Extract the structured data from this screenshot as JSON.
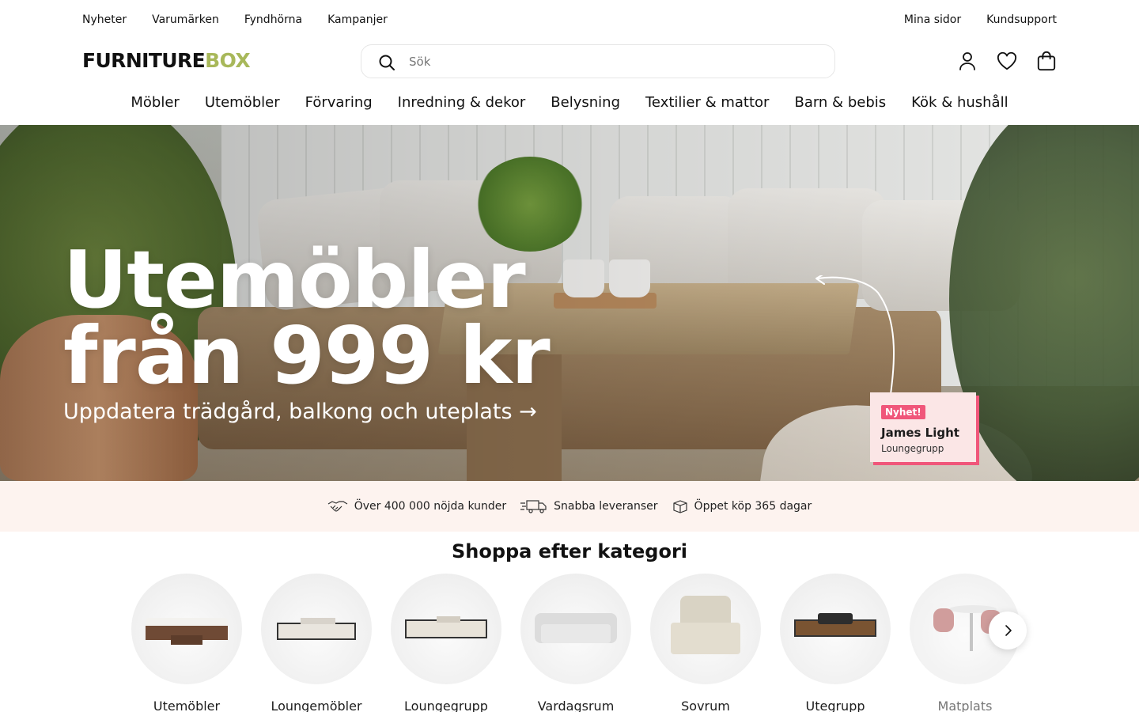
{
  "utility_nav": {
    "left": [
      "Nyheter",
      "Varumärken",
      "Fyndhörna",
      "Kampanjer"
    ],
    "right": [
      "Mina sidor",
      "Kundsupport"
    ]
  },
  "brand": {
    "logo_part1": "FURNITURE",
    "logo_part2": "BOX",
    "accent": "#a8b85a"
  },
  "search": {
    "placeholder": "Sök",
    "icon": "search-icon"
  },
  "header_icons": [
    "account-icon",
    "heart-icon",
    "bag-icon"
  ],
  "main_nav": [
    "Möbler",
    "Utemöbler",
    "Förvaring",
    "Inredning & dekor",
    "Belysning",
    "Textilier & mattor",
    "Barn & bebis",
    "Kök & hushåll"
  ],
  "hero": {
    "title_line1": "Utemöbler",
    "title_line2": "från 999 kr",
    "subtitle": "Uppdatera trädgård, balkong och uteplats →",
    "tag": {
      "badge": "Nyhet!",
      "name": "James Light",
      "type": "Loungegrupp"
    },
    "tag_color": "#f0567a"
  },
  "usps": [
    {
      "icon": "handshake-icon",
      "text": "Över 400 000 nöjda kunder"
    },
    {
      "icon": "truck-icon",
      "text": "Snabba leveranser"
    },
    {
      "icon": "box-icon",
      "text": "Öppet köp 365 dagar"
    }
  ],
  "usp_bg": "#fdf3ef",
  "categories": {
    "title": "Shoppa efter kategori",
    "items": [
      "Utemöbler",
      "Loungemöbler",
      "Loungegrupp",
      "Vardagsrum",
      "Sovrum",
      "Utegrupp",
      "Matplats"
    ]
  }
}
